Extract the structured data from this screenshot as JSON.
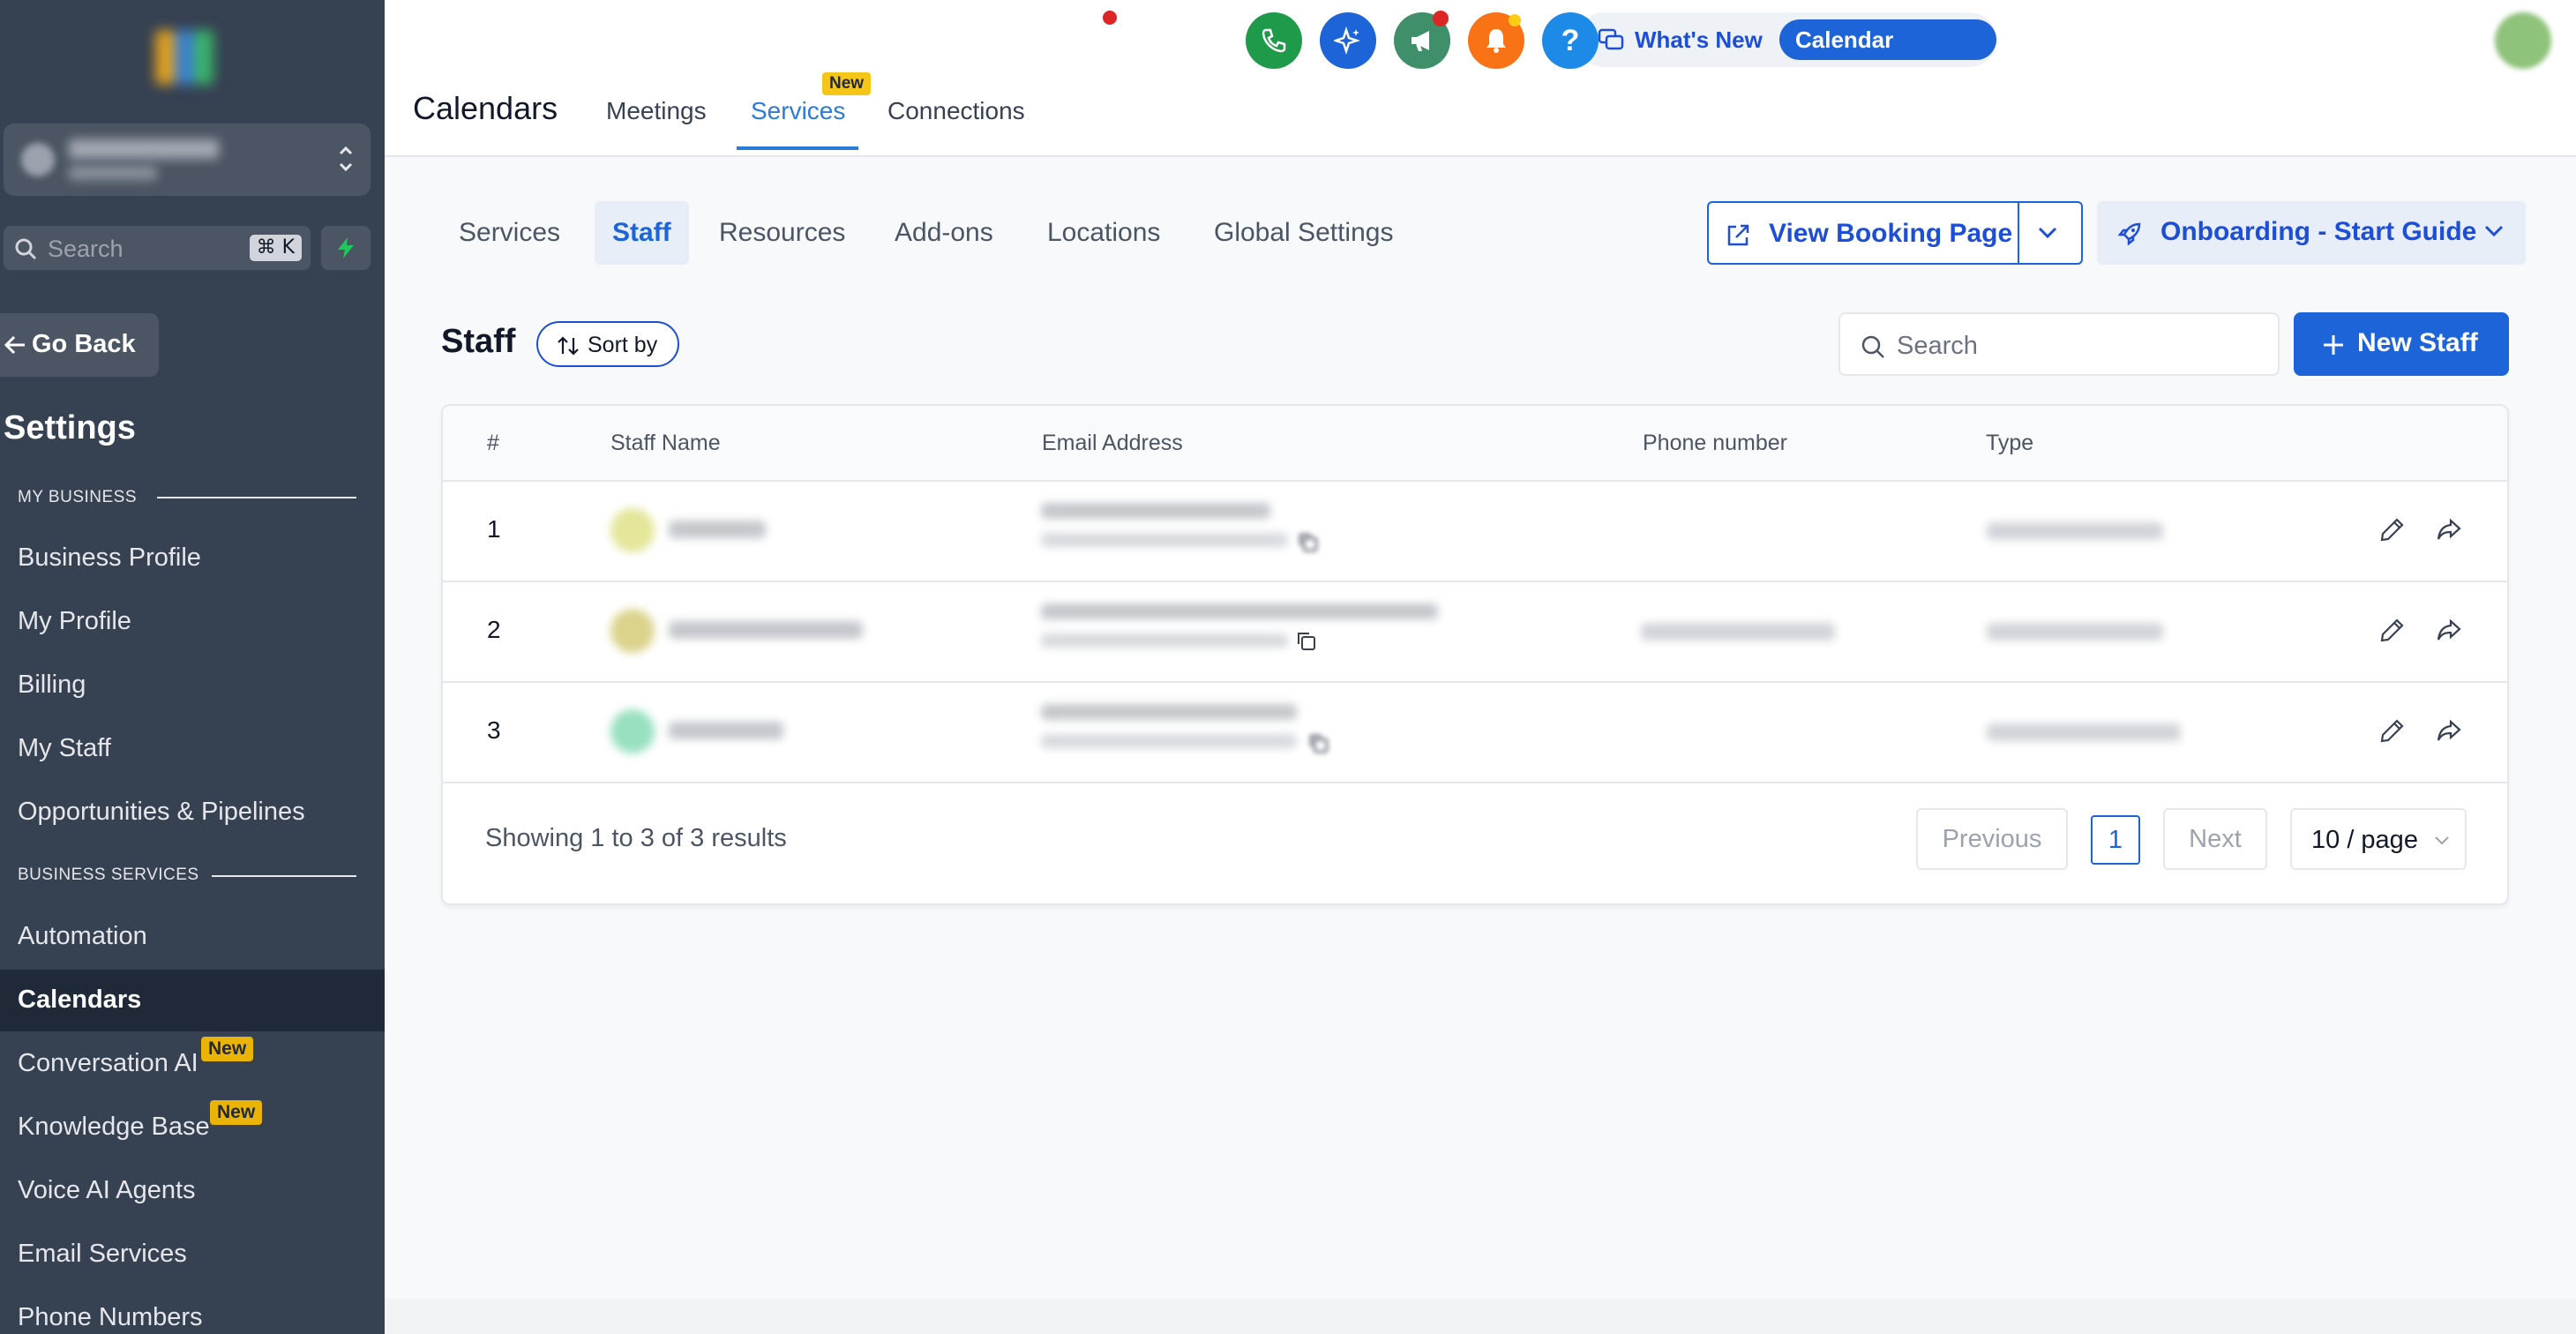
{
  "sidebar": {
    "search_placeholder": "Search",
    "search_shortcut": "⌘ K",
    "go_back": "Go Back",
    "settings_title": "Settings",
    "section_my_business": "MY BUSINESS",
    "section_business_services": "BUSINESS SERVICES",
    "items": [
      {
        "label": "Business Profile"
      },
      {
        "label": "My Profile"
      },
      {
        "label": "Billing"
      },
      {
        "label": "My Staff"
      },
      {
        "label": "Opportunities & Pipelines"
      },
      {
        "label": "Automation"
      },
      {
        "label": "Calendars",
        "active": true
      },
      {
        "label": "Conversation AI",
        "badge": "New"
      },
      {
        "label": "Knowledge Base",
        "badge": "New"
      },
      {
        "label": "Voice AI Agents"
      },
      {
        "label": "Email Services"
      },
      {
        "label": "Phone Numbers"
      }
    ]
  },
  "header": {
    "whats_new": "What's New",
    "calendar_updates": "Calendar Updates",
    "page_title": "Calendars",
    "tabs": [
      {
        "label": "Meetings"
      },
      {
        "label": "Services",
        "active": true,
        "badge": "New"
      },
      {
        "label": "Connections"
      }
    ],
    "help_icon": "?",
    "icons": [
      "phone-icon",
      "sparkle-icon",
      "megaphone-icon",
      "bell-icon",
      "help-icon"
    ],
    "icon_colors": [
      "#1e9a4a",
      "#1d64d8",
      "#3f8f6b",
      "#f97316",
      "#1d8ae8"
    ]
  },
  "subtabs": [
    {
      "label": "Services"
    },
    {
      "label": "Staff",
      "active": true
    },
    {
      "label": "Resources"
    },
    {
      "label": "Add-ons"
    },
    {
      "label": "Locations"
    },
    {
      "label": "Global Settings"
    }
  ],
  "actions": {
    "view_booking_page": "View Booking Page",
    "onboarding": "Onboarding - Start Guide"
  },
  "staff": {
    "title": "Staff",
    "sort_by": "Sort by",
    "search_placeholder": "Search",
    "new_staff": "New Staff"
  },
  "table": {
    "columns": [
      "#",
      "Staff Name",
      "Email Address",
      "Phone number",
      "Type"
    ],
    "rows": [
      {
        "num": "1",
        "has_phone": false
      },
      {
        "num": "2",
        "has_phone": true
      },
      {
        "num": "3",
        "has_phone": false
      }
    ],
    "footer": "Showing 1 to 3 of 3 results",
    "previous": "Previous",
    "page": "1",
    "next": "Next",
    "per_page": "10 / page"
  },
  "colors": {
    "sidebar_bg": "#364152",
    "accent": "#1d64d8",
    "tab_active": "#2b7bd8",
    "new_badge": "#eab308"
  }
}
